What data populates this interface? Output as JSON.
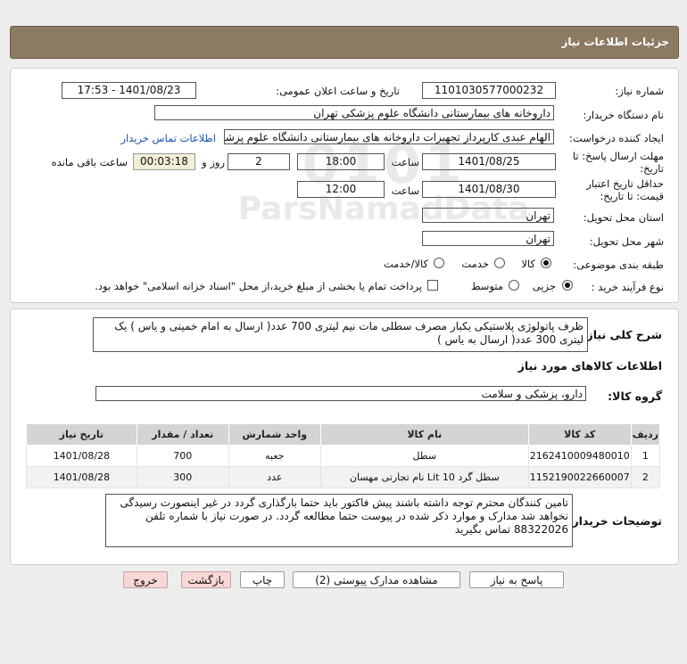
{
  "page": {
    "title": "جزئیات اطلاعات نیاز"
  },
  "fields": {
    "need_number": {
      "label": "شماره نیاز:",
      "value": "1101030577000232"
    },
    "announce_datetime": {
      "label": "تاریخ و ساعت اعلان عمومی:",
      "value": "1401/08/23 - 17:53"
    },
    "buyer_org": {
      "label": "نام دستگاه خریدار:",
      "value": "داروخانه های بیمارستانی دانشگاه علوم پزشکی تهران"
    },
    "requester": {
      "label": "ایجاد کننده درخواست:",
      "value": "الهام عبدی کارپرداز تجهیزات داروخانه های بیمارستانی دانشگاه علوم پزشکی تهران",
      "contact_link": "اطلاعات تماس خریدار"
    },
    "deadline": {
      "label_line1": "مهلت ارسال پاسخ: تا",
      "label_line2": "تاریخ:",
      "date": "1401/08/25",
      "time_label": "ساعت",
      "time": "18:00",
      "days": "2",
      "days_label": "روز و",
      "remaining": "00:03:18",
      "remaining_label": "ساعت باقی مانده"
    },
    "validity": {
      "label_line1": "حداقل تاریخ اعتبار",
      "label_line2": "قیمت: تا تاریخ:",
      "date": "1401/08/30",
      "time_label": "ساعت",
      "time": "12:00"
    },
    "province": {
      "label": "استان محل تحویل:",
      "value": "تهران"
    },
    "city": {
      "label": "شهر محل تحویل:",
      "value": "تهران"
    },
    "category": {
      "label": "طبقه بندی موضوعی:",
      "options": [
        "کالا",
        "خدمت",
        "کالا/خدمت"
      ],
      "selected": "کالا"
    },
    "process": {
      "label": "نوع فرآیند خرید :",
      "options": [
        "جزیی",
        "متوسط"
      ],
      "selected": "جزیی",
      "checkbox_text": "پرداخت تمام یا بخشی از مبلغ خرید،از محل \"اسناد خزانه اسلامی\" خواهد بود."
    }
  },
  "summary": {
    "label": "شرح کلی نیاز:",
    "text": "ظرف پاتولوژی پلاستیکی یکبار مصرف سطلی مات نیم لیتری 700 عدد( ارسال به امام خمینی و یاس ) یک لیتری 300 عدد( ارسال به یاس )"
  },
  "goods_info": {
    "title": "اطلاعات کالاهای مورد نیاز",
    "group_label": "گروه کالا:",
    "group_value": "دارو، پزشکی و سلامت",
    "columns": [
      "ردیف",
      "کد کالا",
      "نام کالا",
      "واحد شمارش",
      "تعداد / مقدار",
      "تاریخ نیاز"
    ],
    "rows": [
      [
        "1",
        "2162410009480010",
        "سطل",
        "جعبه",
        "700",
        "1401/08/28"
      ],
      [
        "2",
        "1152190022660007",
        "سطل گرد Lit 10 نام تجارتی مهسان",
        "عدد",
        "300",
        "1401/08/28"
      ]
    ]
  },
  "buyer_notes": {
    "label": "توضیحات خریدار:",
    "text": "تامین کنندگان محترم توجه داشته باشند پیش فاکتور باید حتما بارگذاری گردد در غیر اینصورت رسیدگی نخواهد شد مدارک و موارد ذکر شده در پیوست حتما مطالعه گردد. در صورت نیاز با شماره تلفن 88322026 تماس بگیرید"
  },
  "buttons": {
    "reply": "پاسخ به نیاز",
    "attachments": "مشاهده مدارک پیوستی (2)",
    "print": "چاپ",
    "back": "بازگشت",
    "exit": "خروج"
  },
  "colors": {
    "header": "#8c7a63",
    "table_header": "#d4d4d4",
    "yellow_box": "#f2f0d6",
    "exit_button": "#f8d7d7"
  }
}
